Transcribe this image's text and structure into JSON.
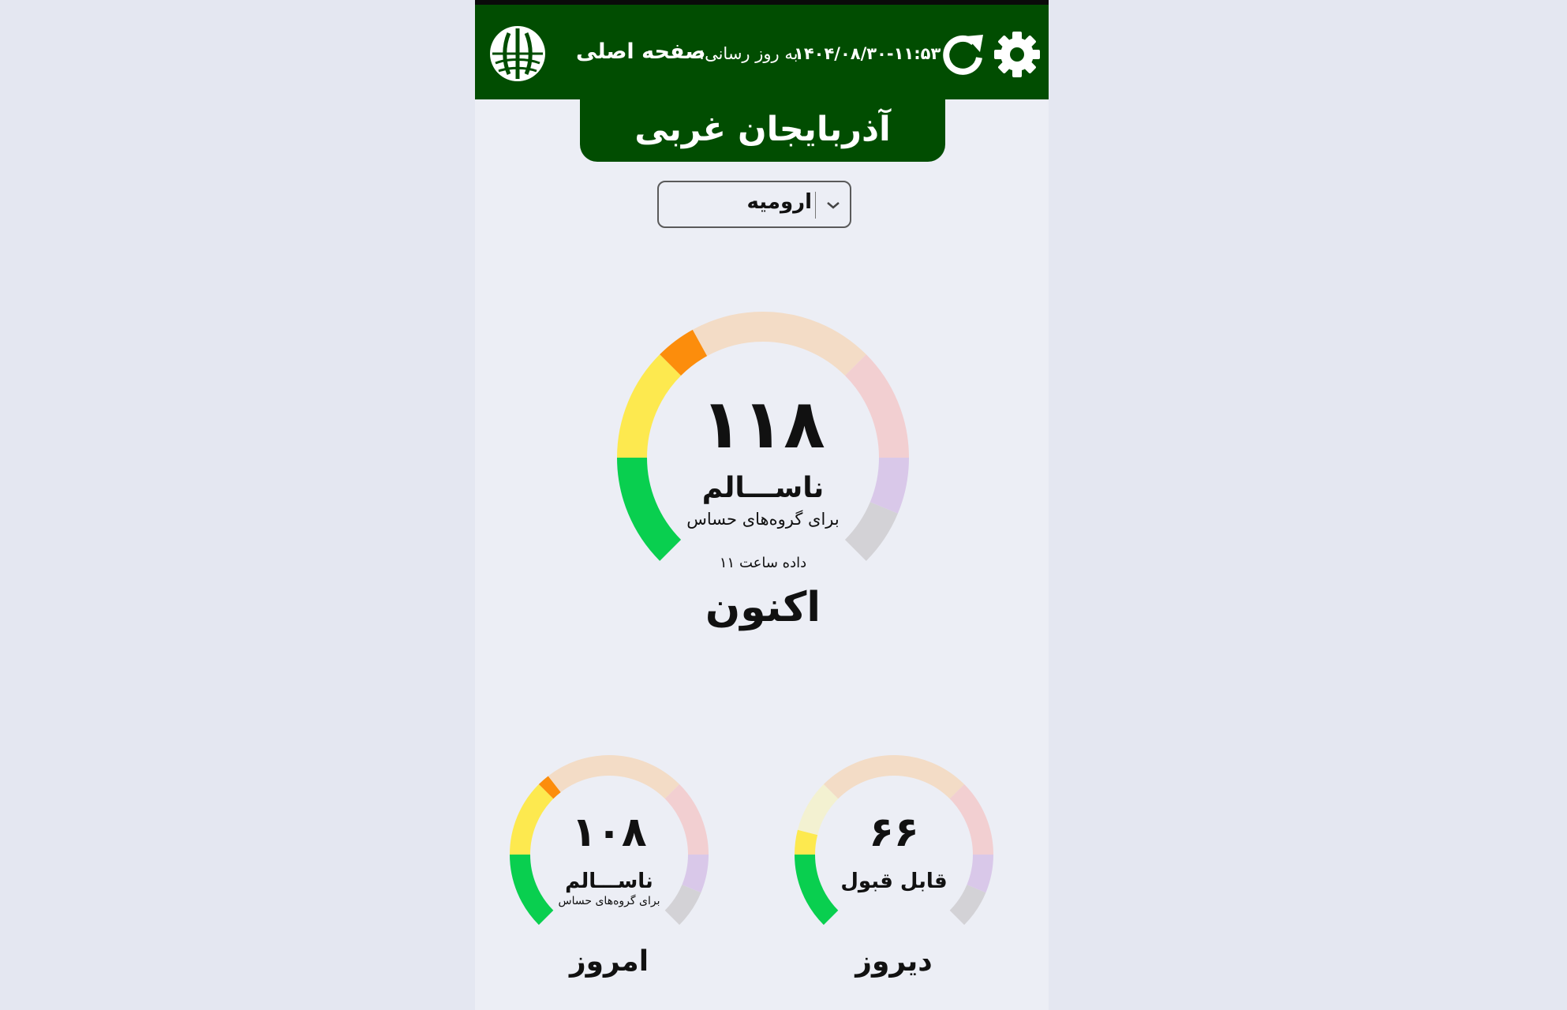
{
  "header": {
    "home_label": "صفحه اصلی",
    "update_label": "به روز رسانی:",
    "update_time": "۱۴۰۴/۰۸/۳۰-۱۱:۵۳",
    "logo_icon": "environment-org-logo-icon",
    "refresh_icon": "refresh-icon",
    "settings_icon": "gear-icon",
    "bar_color": "#014d01"
  },
  "province": {
    "title": "آذربایجان غربی"
  },
  "city_select": {
    "selected": "ارومیه",
    "icon": "chevron-down-icon"
  },
  "scale_colors": {
    "good": "#09cf4f",
    "moderate": "#fde94f",
    "sensitive": "#fc8d0c",
    "unhealthy": "#f3dcc6",
    "very_unhealthy": "#f2cfd1",
    "hazardous": "#d9c8e9",
    "empty": "#d3d2d6",
    "moderate_pale": "#f3f1d1"
  },
  "gauges": {
    "now": {
      "value_text": "۱۱۸",
      "value": 118,
      "status": "ناســـالم",
      "sub": "برای گروه‌های حساس",
      "time_note": "داده ساعت ۱۱",
      "caption": "اکنون"
    },
    "today": {
      "value_text": "۱۰۸",
      "value": 108,
      "status": "ناســـالم",
      "sub": "برای گروه‌های حساس",
      "caption": "امروز"
    },
    "yesterday": {
      "value_text": "۶۶",
      "value": 66,
      "status": "قابل قبول",
      "caption": "دیروز"
    }
  }
}
